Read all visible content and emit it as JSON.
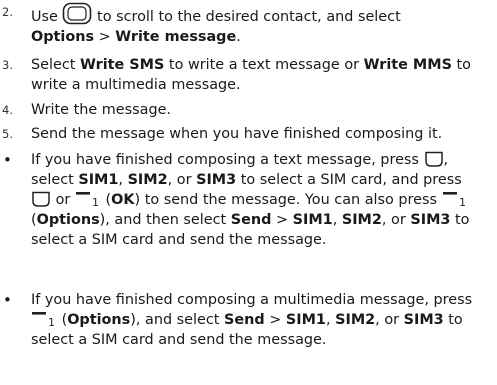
{
  "steps": [
    {
      "number": "2.",
      "text": {
        "a": "Use",
        "b": "to scroll to the desired contact, and select",
        "options": "Options",
        "sep": ">",
        "write_message": "Write message",
        "end": "."
      },
      "icon": "navigation-key-icon"
    },
    {
      "number": "3.",
      "text": {
        "a": "Select",
        "write_sms": "Write SMS",
        "b": "to write a text message or",
        "write_mms": "Write MMS",
        "c": "to write a multimedia message."
      }
    },
    {
      "number": "4.",
      "text": "Write the message."
    },
    {
      "number": "5.",
      "text": "Send the message when you have finished composing it."
    }
  ],
  "bullets": [
    {
      "marker": "•",
      "text": {
        "a": "If you have finished composing a text message, press",
        "b": ",",
        "c": "select",
        "sim1": "SIM1",
        "comma1": ",",
        "sim2": "SIM2",
        "or1": ", or",
        "sim3": "SIM3",
        "d": "to select a SIM card, and press",
        "or2": "or",
        "ok_open": "(",
        "ok": "OK",
        "ok_close": ")",
        "e": "to send the message. You can also press",
        "opt_open": "(",
        "options": "Options",
        "opt_close": "), and then select",
        "send": "Send",
        "sep": ">",
        "sim1b": "SIM1",
        "comma2": ",",
        "sim2b": "SIM2",
        "or3": ", or",
        "sim3b": "SIM3",
        "f": "to select a SIM card and send the message."
      },
      "icons": [
        "end-key-icon",
        "end-key-icon",
        "left-soft-key-icon",
        "left-soft-key-icon"
      ]
    },
    {
      "marker": "•",
      "text": {
        "a": "If you have finished composing a multimedia message, press",
        "opt_open": "(",
        "options": "Options",
        "opt_close": "), and select",
        "send": "Send",
        "sep": ">",
        "sim1": "SIM1",
        "comma": ",",
        "sim2": "SIM2",
        "or": ", or",
        "sim3": "SIM3",
        "b": "to select a SIM card and send the message."
      },
      "icons": [
        "left-soft-key-icon"
      ]
    }
  ]
}
